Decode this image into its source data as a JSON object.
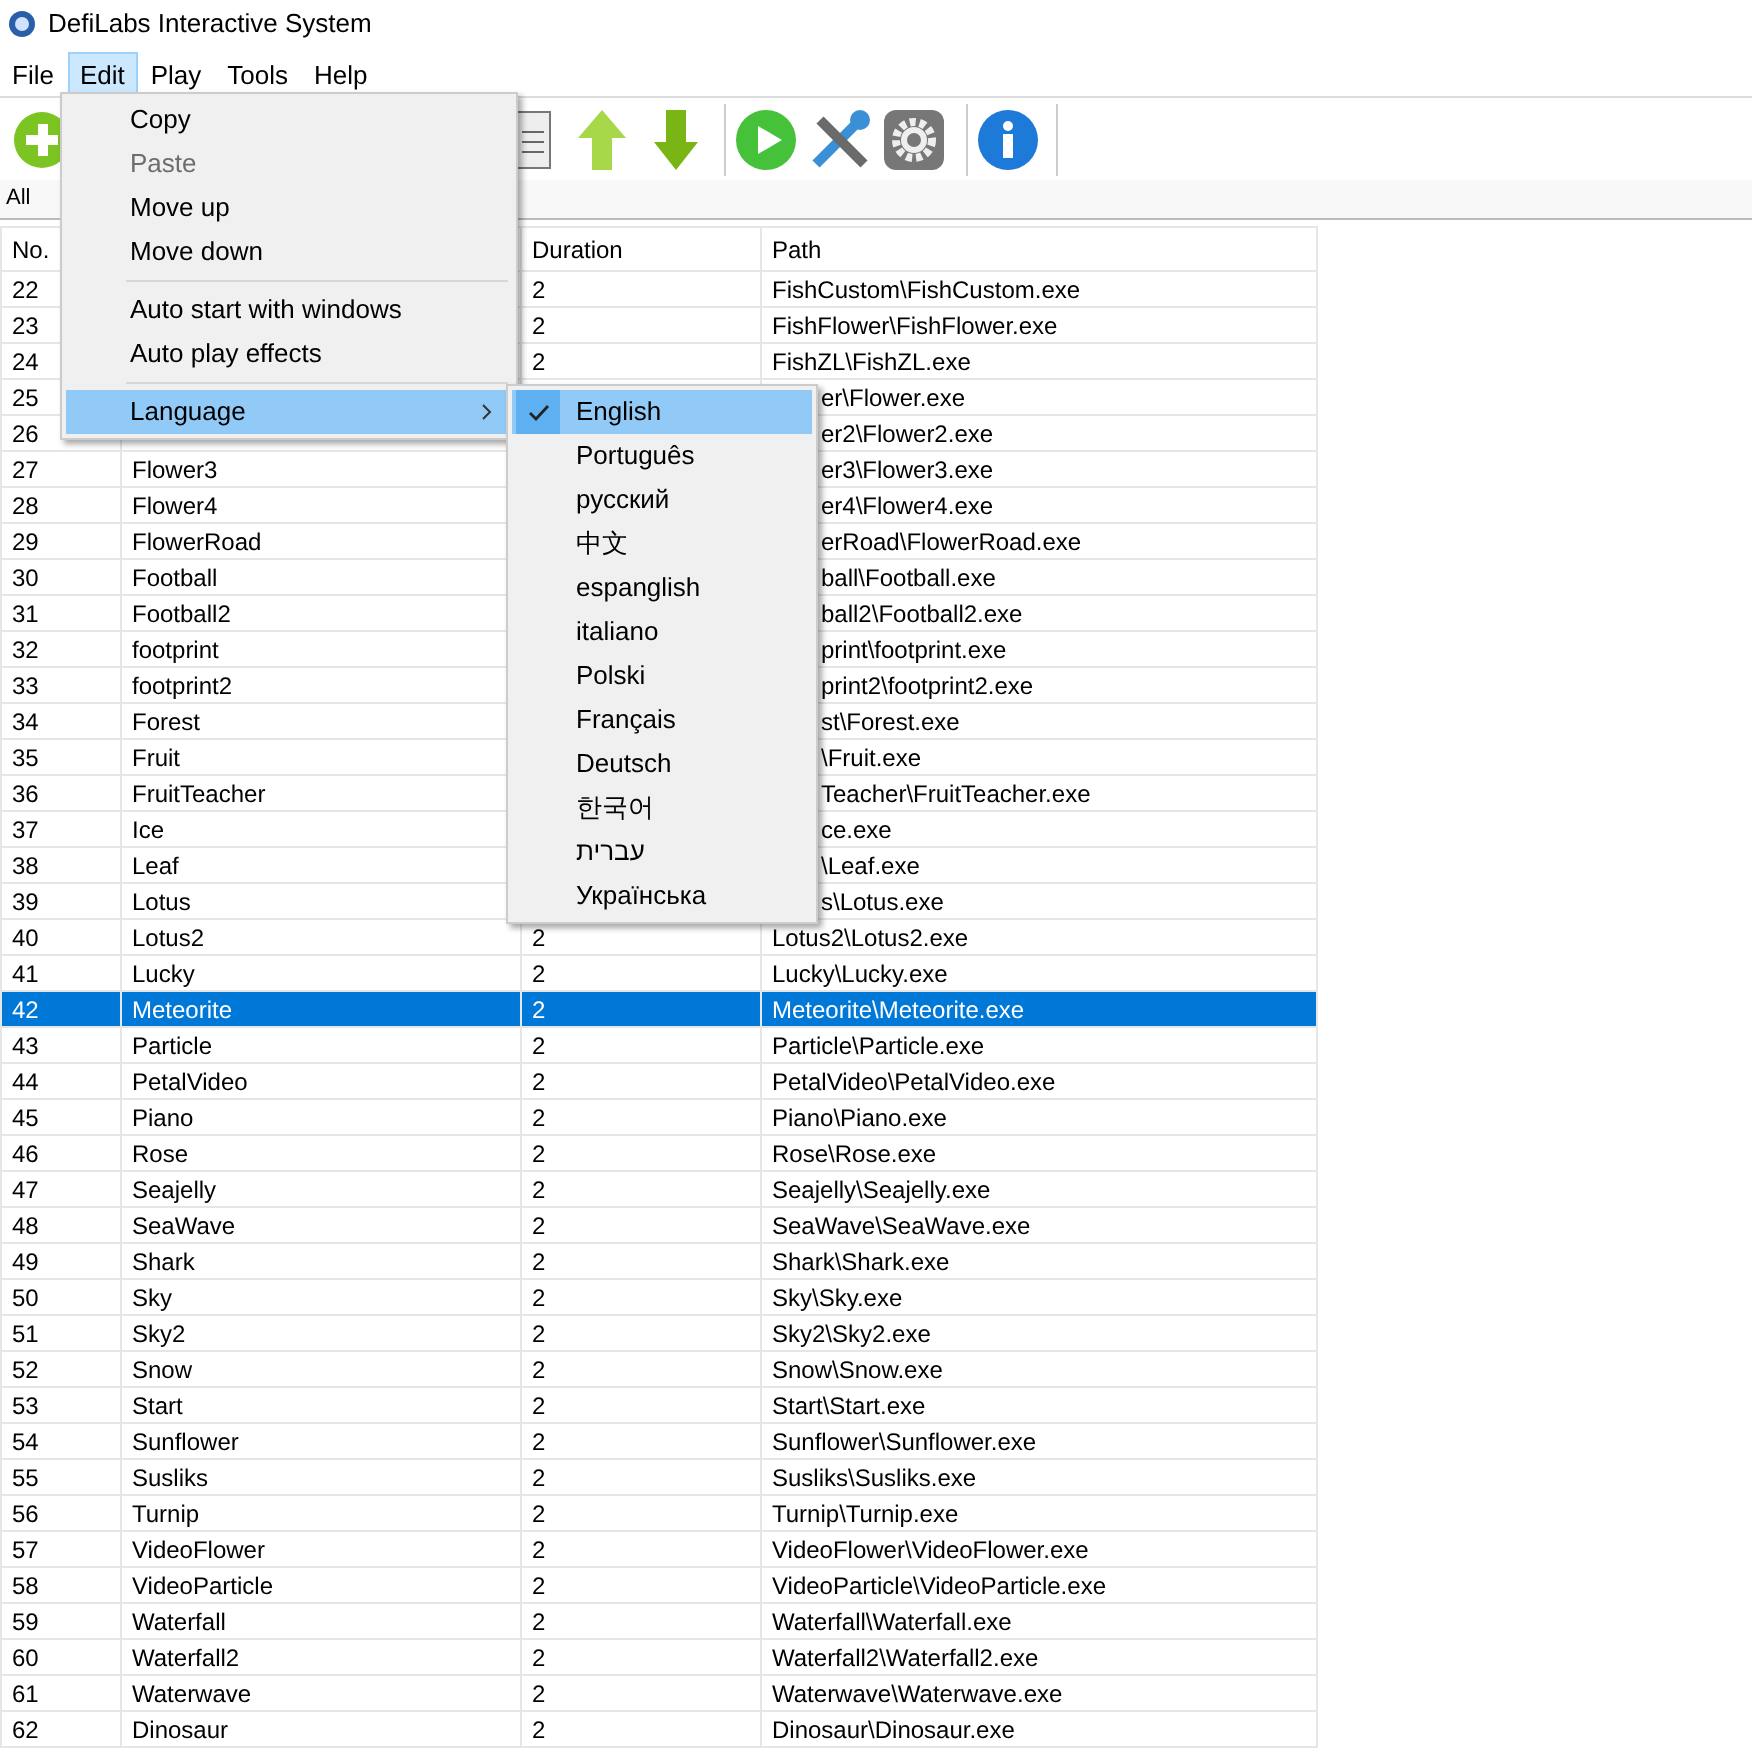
{
  "window": {
    "title": "DefiLabs Interactive System"
  },
  "menu_bar": [
    {
      "label": "File",
      "selected": false
    },
    {
      "label": "Edit",
      "selected": true
    },
    {
      "label": "Play",
      "selected": false
    },
    {
      "label": "Tools",
      "selected": false
    },
    {
      "label": "Help",
      "selected": false
    }
  ],
  "edit_menu": [
    {
      "kind": "item",
      "label": "Copy",
      "disabled": false,
      "selected": false
    },
    {
      "kind": "item",
      "label": "Paste",
      "disabled": true,
      "selected": false
    },
    {
      "kind": "item",
      "label": "Move up",
      "disabled": false,
      "selected": false
    },
    {
      "kind": "item",
      "label": "Move down",
      "disabled": false,
      "selected": false
    },
    {
      "kind": "separator"
    },
    {
      "kind": "item",
      "label": "Auto start with windows",
      "disabled": false,
      "selected": false
    },
    {
      "kind": "item",
      "label": "Auto play effects",
      "disabled": false,
      "selected": false
    },
    {
      "kind": "separator"
    },
    {
      "kind": "submenu",
      "label": "Language",
      "disabled": false,
      "selected": true
    }
  ],
  "language_menu": [
    {
      "label": "English",
      "selected": true
    },
    {
      "label": "Português",
      "selected": false
    },
    {
      "label": "русский",
      "selected": false
    },
    {
      "label": "中文",
      "selected": false
    },
    {
      "label": "espanglish",
      "selected": false
    },
    {
      "label": "italiano",
      "selected": false
    },
    {
      "label": "Polski",
      "selected": false
    },
    {
      "label": "Français",
      "selected": false
    },
    {
      "label": "Deutsch",
      "selected": false
    },
    {
      "label": "한국어",
      "selected": false
    },
    {
      "label": "עברית",
      "selected": false
    },
    {
      "label": "Українська",
      "selected": false
    }
  ],
  "filter": {
    "label": "All"
  },
  "table": {
    "headers": {
      "no": "No.",
      "duration": "Duration",
      "path": "Path"
    },
    "rows": [
      {
        "no": "22",
        "duration": "2",
        "path": "FishCustom\\FishCustom.exe",
        "selected": false
      },
      {
        "no": "23",
        "duration": "2",
        "path": "FishFlower\\FishFlower.exe",
        "selected": false
      },
      {
        "no": "24",
        "duration": "2",
        "path": "FishZL\\FishZL.exe",
        "selected": false
      },
      {
        "no": "25",
        "path": "er\\Flower.exe",
        "selected": false
      },
      {
        "no": "26",
        "path": "er2\\Flower2.exe",
        "selected": false
      },
      {
        "no": "27",
        "name": "Flower3",
        "path": "er3\\Flower3.exe",
        "selected": false
      },
      {
        "no": "28",
        "name": "Flower4",
        "path": "er4\\Flower4.exe",
        "selected": false
      },
      {
        "no": "29",
        "name": "FlowerRoad",
        "path": "erRoad\\FlowerRoad.exe",
        "selected": false
      },
      {
        "no": "30",
        "name": "Football",
        "path": "ball\\Football.exe",
        "selected": false
      },
      {
        "no": "31",
        "name": "Football2",
        "path": "ball2\\Football2.exe",
        "selected": false
      },
      {
        "no": "32",
        "name": "footprint",
        "path": "print\\footprint.exe",
        "selected": false
      },
      {
        "no": "33",
        "name": "footprint2",
        "path": "print2\\footprint2.exe",
        "selected": false
      },
      {
        "no": "34",
        "name": "Forest",
        "path": "st\\Forest.exe",
        "selected": false
      },
      {
        "no": "35",
        "name": "Fruit",
        "path": "\\Fruit.exe",
        "selected": false
      },
      {
        "no": "36",
        "name": "FruitTeacher",
        "path": "Teacher\\FruitTeacher.exe",
        "selected": false
      },
      {
        "no": "37",
        "name": "Ice",
        "path": "ce.exe",
        "selected": false
      },
      {
        "no": "38",
        "name": "Leaf",
        "path": "\\Leaf.exe",
        "selected": false
      },
      {
        "no": "39",
        "name": "Lotus",
        "path": "s\\Lotus.exe",
        "selected": false
      },
      {
        "no": "40",
        "name": "Lotus2",
        "duration": "2",
        "path": "Lotus2\\Lotus2.exe",
        "selected": false
      },
      {
        "no": "41",
        "name": "Lucky",
        "duration": "2",
        "path": "Lucky\\Lucky.exe",
        "selected": false
      },
      {
        "no": "42",
        "name": "Meteorite",
        "duration": "2",
        "path": "Meteorite\\Meteorite.exe",
        "selected": true
      },
      {
        "no": "43",
        "name": "Particle",
        "duration": "2",
        "path": "Particle\\Particle.exe",
        "selected": false
      },
      {
        "no": "44",
        "name": "PetalVideo",
        "duration": "2",
        "path": "PetalVideo\\PetalVideo.exe",
        "selected": false
      },
      {
        "no": "45",
        "name": "Piano",
        "duration": "2",
        "path": "Piano\\Piano.exe",
        "selected": false
      },
      {
        "no": "46",
        "name": "Rose",
        "duration": "2",
        "path": "Rose\\Rose.exe",
        "selected": false
      },
      {
        "no": "47",
        "name": "Seajelly",
        "duration": "2",
        "path": "Seajelly\\Seajelly.exe",
        "selected": false
      },
      {
        "no": "48",
        "name": "SeaWave",
        "duration": "2",
        "path": "SeaWave\\SeaWave.exe",
        "selected": false
      },
      {
        "no": "49",
        "name": "Shark",
        "duration": "2",
        "path": "Shark\\Shark.exe",
        "selected": false
      },
      {
        "no": "50",
        "name": "Sky",
        "duration": "2",
        "path": "Sky\\Sky.exe",
        "selected": false
      },
      {
        "no": "51",
        "name": "Sky2",
        "duration": "2",
        "path": "Sky2\\Sky2.exe",
        "selected": false
      },
      {
        "no": "52",
        "name": "Snow",
        "duration": "2",
        "path": "Snow\\Snow.exe",
        "selected": false
      },
      {
        "no": "53",
        "name": "Start",
        "duration": "2",
        "path": "Start\\Start.exe",
        "selected": false
      },
      {
        "no": "54",
        "name": "Sunflower",
        "duration": "2",
        "path": "Sunflower\\Sunflower.exe",
        "selected": false
      },
      {
        "no": "55",
        "name": "Susliks",
        "duration": "2",
        "path": "Susliks\\Susliks.exe",
        "selected": false
      },
      {
        "no": "56",
        "name": "Turnip",
        "duration": "2",
        "path": "Turnip\\Turnip.exe",
        "selected": false
      },
      {
        "no": "57",
        "name": "VideoFlower",
        "duration": "2",
        "path": "VideoFlower\\VideoFlower.exe",
        "selected": false
      },
      {
        "no": "58",
        "name": "VideoParticle",
        "duration": "2",
        "path": "VideoParticle\\VideoParticle.exe",
        "selected": false
      },
      {
        "no": "59",
        "name": "Waterfall",
        "duration": "2",
        "path": "Waterfall\\Waterfall.exe",
        "selected": false
      },
      {
        "no": "60",
        "name": "Waterfall2",
        "duration": "2",
        "path": "Waterfall2\\Waterfall2.exe",
        "selected": false
      },
      {
        "no": "61",
        "name": "Waterwave",
        "duration": "2",
        "path": "Waterwave\\Waterwave.exe",
        "selected": false
      },
      {
        "no": "62",
        "name": "Dinosaur",
        "duration": "2",
        "path": "Dinosaur\\Dinosaur.exe",
        "selected": false
      }
    ]
  }
}
